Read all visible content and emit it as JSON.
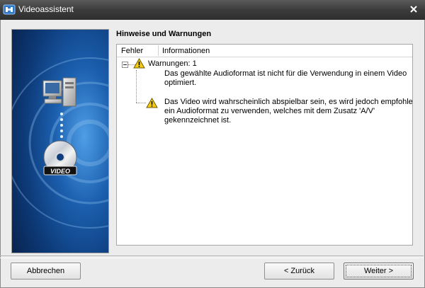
{
  "window": {
    "title": "Videoassistent"
  },
  "colors": {
    "titlebar": "#3c3c3c",
    "side_panel": "#0f3e7a",
    "warning": "#f5cc12"
  },
  "sidebar": {
    "badge_label": "VIDEO"
  },
  "section": {
    "heading": "Hinweise und Warnungen"
  },
  "list": {
    "columns": [
      "Fehler",
      "Informationen"
    ],
    "group": {
      "label": "Warnungen: 1"
    },
    "items": [
      {
        "lines": [
          "Das gewählte Audioformat ist nicht für die Verwendung in einem Video",
          "optimiert."
        ]
      },
      {
        "lines": [
          "Das Video wird wahrscheinlich abspielbar sein, es wird jedoch empfohlen",
          "ein Audioformat zu verwenden, welches mit dem Zusatz 'A/V'",
          "gekennzeichnet ist."
        ]
      }
    ]
  },
  "buttons": {
    "cancel": "Abbrechen",
    "back": "< Zurück",
    "next": "Weiter >"
  },
  "icons": {
    "app": "video-assistant-icon",
    "close": "close-icon",
    "warning": "warning-triangle-icon",
    "computer": "computer-icon",
    "disc": "video-disc-icon"
  }
}
